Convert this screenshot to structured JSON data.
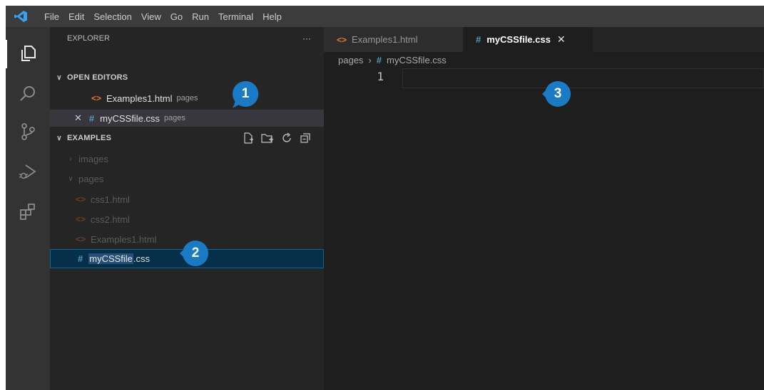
{
  "menu": [
    "File",
    "Edit",
    "Selection",
    "View",
    "Go",
    "Run",
    "Terminal",
    "Help"
  ],
  "sidebar": {
    "title": "EXPLORER",
    "more": "···",
    "open_editors": {
      "header": "OPEN EDITORS",
      "items": [
        {
          "name": "Examples1.html",
          "hint": "pages"
        },
        {
          "name": "myCSSfile.css",
          "hint": "pages",
          "close": "✕"
        }
      ]
    },
    "folder": {
      "header": "EXAMPLES",
      "tree": [
        {
          "label": "images"
        },
        {
          "label": "pages"
        },
        {
          "label": "css1.html"
        },
        {
          "label": "css2.html"
        },
        {
          "label": "Examples1.html"
        }
      ],
      "rename": {
        "selected": "myCSSfile",
        "rest": ".css"
      }
    }
  },
  "tabs": [
    {
      "label": "Examples1.html"
    },
    {
      "label": "myCSSfile.css",
      "close": "✕"
    }
  ],
  "breadcrumb": {
    "folder": "pages",
    "sep": "›",
    "icon": "#",
    "file": "myCSSfile.css"
  },
  "editor": {
    "line_number": "1"
  },
  "callouts": [
    "1",
    "2",
    "3"
  ],
  "colors": {
    "accent": "#1a7bc4",
    "html_icon": "#e37933",
    "css_icon": "#519aba",
    "selection": "#264f78"
  },
  "icons": [
    "vscode-logo-icon",
    "explorer-icon",
    "search-icon",
    "source-control-icon",
    "run-debug-icon",
    "extensions-icon",
    "new-file-icon",
    "new-folder-icon",
    "refresh-icon",
    "collapse-all-icon"
  ]
}
